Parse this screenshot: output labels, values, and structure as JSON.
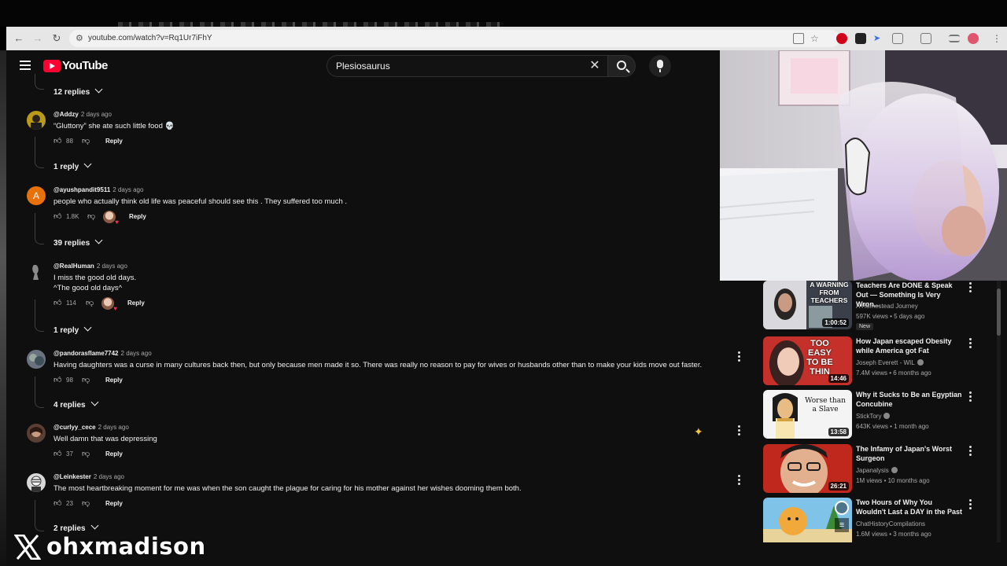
{
  "browser": {
    "url": "youtube.com/watch?v=Rq1Ur7iFhY"
  },
  "header": {
    "logo_text": "YouTube",
    "search_query": "Plesiosaurus"
  },
  "comments": [
    {
      "toggle": "12 replies"
    },
    {
      "handle": "@Addzy",
      "time": "2 days ago",
      "text": "“Gluttony” she ate such little food 💀",
      "likes": "88",
      "reply": "Reply",
      "toggle": "1 reply"
    },
    {
      "handle": "@ayushpandit9511",
      "time": "2 days ago",
      "avatar_letter": "A",
      "text": "people who actually think old life was peaceful should see this . They suffered too much .",
      "likes": "1.8K",
      "reply": "Reply",
      "toggle": "39 replies"
    },
    {
      "handle": "@RealHuman",
      "time": "2 days ago",
      "text": "I miss the good old days.",
      "text2": "^The good old days^",
      "likes": "114",
      "reply": "Reply",
      "toggle": "1 reply"
    },
    {
      "handle": "@pandorasflame7742",
      "time": "2 days ago",
      "text": "Having daughters was a curse in many cultures back then, but only because men made it so. There was really no reason to pay for wives or husbands other than to make your kids move out faster.",
      "likes": "98",
      "reply": "Reply",
      "toggle": "4 replies"
    },
    {
      "handle": "@curlyy_cece",
      "time": "2 days ago",
      "text": "Well damn that was depressing",
      "likes": "37",
      "reply": "Reply"
    },
    {
      "handle": "@Leinkester",
      "time": "2 days ago",
      "text": "The most heartbreaking moment for me was when the son caught the plague for caring for his mother against her wishes dooming them both.",
      "likes": "23",
      "reply": "Reply",
      "toggle": "2 replies"
    }
  ],
  "recommendations": [
    {
      "title": "Teachers Are DONE & Speak Out — Something Is Very Wron...",
      "channel": "A Homestead Journey",
      "views": "597K views • 5 days ago",
      "badge": "New",
      "duration": "1:00:52",
      "thumb_text": "A WARNING FROM TEACHERS"
    },
    {
      "title": "How Japan escaped Obesity while America got Fat",
      "channel": "Joseph Everett - WIL",
      "views": "7.4M views • 6 months ago",
      "duration": "14:46",
      "thumb_text": "TOO EASY TO BE THIN"
    },
    {
      "title": "Why it Sucks to Be an Egyptian Concubine",
      "channel": "StickTory",
      "views": "643K views • 1 month ago",
      "duration": "13:58",
      "thumb_text": "Worse than a Slave"
    },
    {
      "title": "The Infamy of Japan's Worst Surgeon",
      "channel": "Japanalysis",
      "views": "1M views • 10 months ago",
      "duration": "26:21"
    },
    {
      "title": "Two Hours of Why You Wouldn't Last a DAY in the Past",
      "channel": "ChatHistoryCompilations",
      "views": "1.6M views • 3 months ago"
    }
  ],
  "watermark": {
    "name": "ohxmadison",
    "icon": "x-logo-icon"
  }
}
